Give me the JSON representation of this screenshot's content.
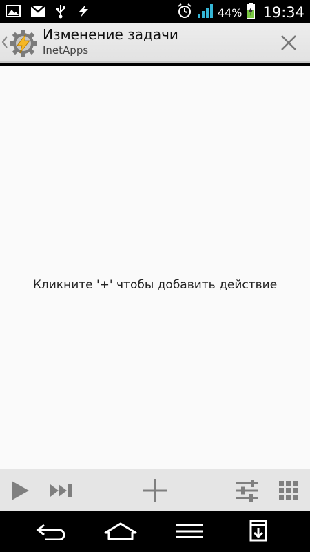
{
  "status_bar": {
    "battery_percent": "44%",
    "time": "19:34",
    "icons": [
      "picture-icon",
      "gmail-icon",
      "usb-icon",
      "tasker-bolt-icon",
      "alarm-clock-icon",
      "signal-icon",
      "battery-charging-icon"
    ]
  },
  "action_bar": {
    "title": "Изменение задачи",
    "subtitle": "InetApps"
  },
  "main": {
    "empty_hint": "Кликните '+' чтобы добавить действие"
  },
  "toolbar": {
    "buttons": [
      "play-icon",
      "step-forward-icon",
      "add-icon",
      "sliders-icon",
      "grid-icon"
    ]
  },
  "navbar": {
    "buttons": [
      "back-icon",
      "home-icon",
      "menu-icon",
      "download-icon"
    ]
  },
  "colors": {
    "status_bar_bg": "#000000",
    "action_bar_bg": "#e8e8e8",
    "content_bg": "#fafafa",
    "toolbar_bg": "#e5e5e5",
    "toolbar_icon": "#7f7f7f",
    "battery_green": "#7ac943",
    "signal_teal": "#35b6d6"
  }
}
